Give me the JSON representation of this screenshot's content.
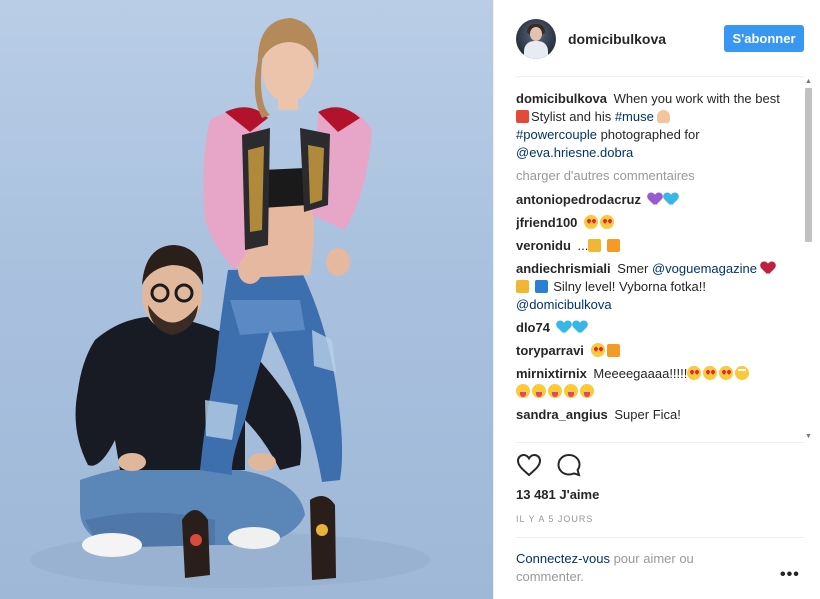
{
  "post": {
    "username": "domicibulkova",
    "follow_label": "S'abonner",
    "caption": {
      "username": "domicibulkova",
      "part1": "When you work with the best",
      "part2": "Stylist and his",
      "hashtag1": "#muse",
      "hashtag2": "#powercouple",
      "part3": "photographed for",
      "mention": "@eva.hriesne.dobra"
    },
    "load_more": "charger d'autres commentaires",
    "comments": [
      {
        "user": "antoniopedrodacruz",
        "text": ""
      },
      {
        "user": "jfriend100",
        "text": ""
      },
      {
        "user": "veronidu",
        "text": "..."
      },
      {
        "user": "andiechrismiali",
        "text": "Smer",
        "mention1": "@voguemagazine",
        "text2": "Silny level! Vyborna fotka!!",
        "mention2": "@domicibulkova"
      },
      {
        "user": "dlo74",
        "text": ""
      },
      {
        "user": "toryparravi",
        "text": ""
      },
      {
        "user": "mirnixtirnix",
        "text": "Meeeegaaaa!!!!!"
      },
      {
        "user": "sandra_angius",
        "text": "Super Fica!"
      }
    ],
    "likes": "13 481 J'aime",
    "time": "IL Y A 5 JOURS",
    "login_link": "Connectez-vous",
    "login_text": "pour aimer ou commenter.",
    "more_label": "•••"
  },
  "icons": {
    "like": "heart-outline-icon",
    "comment": "speech-bubble-icon",
    "more": "ellipsis-icon"
  },
  "colors": {
    "accent": "#3897f0",
    "link": "#003569",
    "muted": "#999999",
    "photo_bg": "#a9c1de"
  }
}
